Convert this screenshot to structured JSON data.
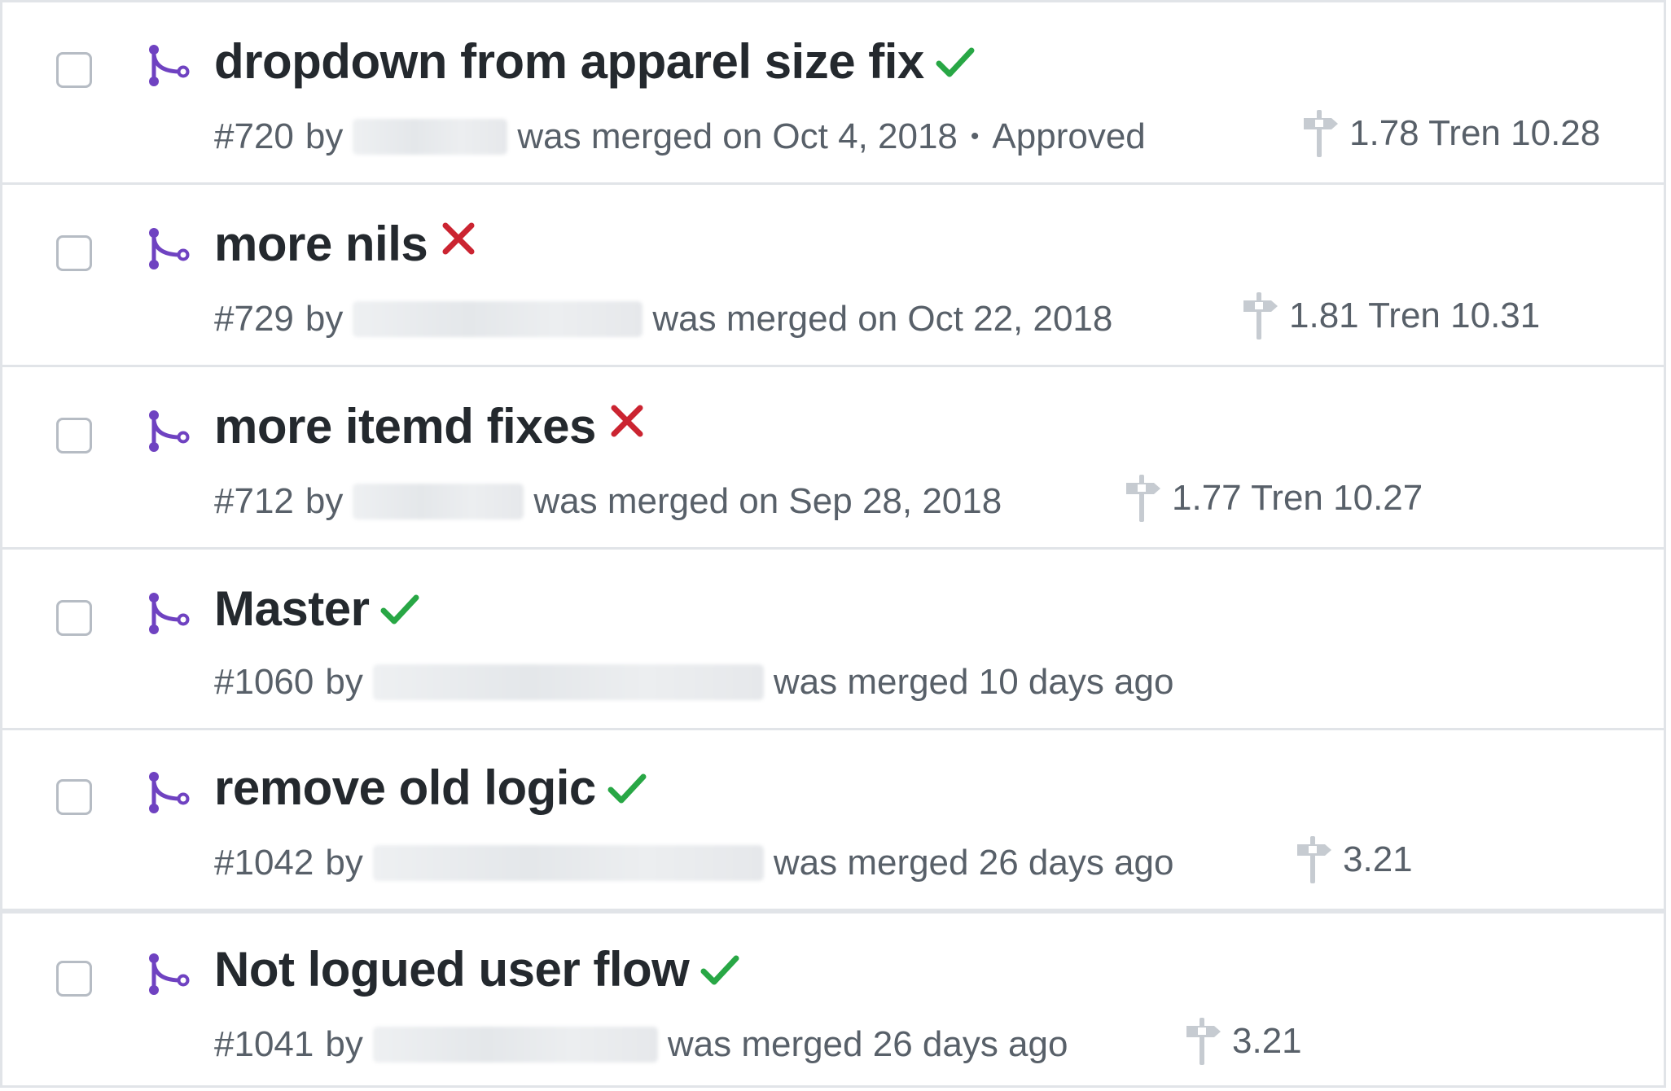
{
  "colors": {
    "merged_purple": "#6f42c1",
    "success_green": "#28a745",
    "failure_red": "#cb2431",
    "text_dark": "#24292e",
    "text_muted": "#586069"
  },
  "pull_requests": [
    {
      "title": "dropdown from apparel size fix",
      "status": "success",
      "number": "#720",
      "by": "by",
      "merged_text": "was merged on Oct 4, 2018",
      "review": "Approved",
      "milestone": "1.78 Tren 10.28"
    },
    {
      "title": "more nils",
      "status": "failure",
      "number": "#729",
      "by": "by",
      "merged_text": "was merged on Oct 22, 2018",
      "milestone": "1.81 Tren 10.31"
    },
    {
      "title": "more itemd fixes",
      "status": "failure",
      "number": "#712",
      "by": "by",
      "merged_text": "was merged on Sep 28, 2018",
      "milestone": "1.77 Tren 10.27"
    },
    {
      "title": "Master",
      "status": "success",
      "number": "#1060",
      "by": "by",
      "merged_text": "was merged 10 days ago"
    },
    {
      "title": "remove old logic",
      "status": "success",
      "number": "#1042",
      "by": "by",
      "merged_text": "was merged 26 days ago",
      "milestone": "3.21"
    },
    {
      "title": "Not logued user flow",
      "status": "success",
      "number": "#1041",
      "by": "by",
      "merged_text": "was merged 26 days ago",
      "milestone": "3.21"
    }
  ]
}
